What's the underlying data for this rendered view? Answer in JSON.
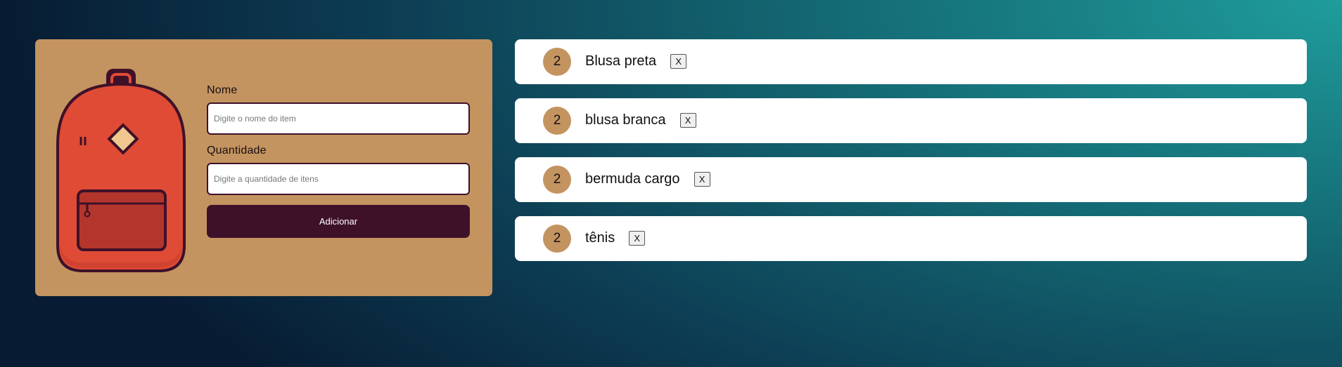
{
  "form": {
    "name_label": "Nome",
    "name_placeholder": "Digite o nome do item",
    "name_value": "",
    "quantity_label": "Quantidade",
    "quantity_placeholder": "Digite a quantidade de itens",
    "quantity_value": "",
    "submit_label": "Adicionar"
  },
  "items": [
    {
      "quantity": "2",
      "name": "Blusa preta",
      "remove_label": "X"
    },
    {
      "quantity": "2",
      "name": "blusa branca",
      "remove_label": "X"
    },
    {
      "quantity": "2",
      "name": "bermuda cargo",
      "remove_label": "X"
    },
    {
      "quantity": "2",
      "name": "tênis",
      "remove_label": "X"
    }
  ],
  "icons": {
    "illustration": "backpack-icon"
  },
  "colors": {
    "card": "#c39460",
    "accent": "#3e1129",
    "backpack": "#e04b35",
    "pocket": "#b3352b",
    "badge": "#c39460"
  }
}
